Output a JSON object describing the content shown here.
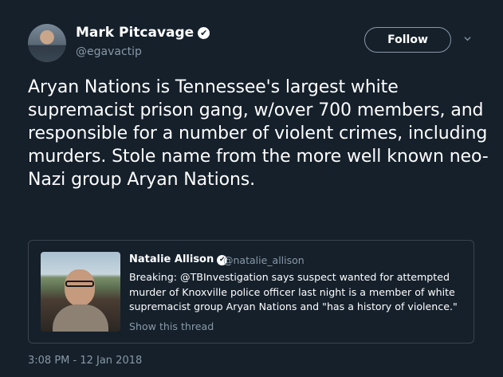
{
  "tweet": {
    "author_name": "Mark Pitcavage",
    "author_handle": "@egavactip",
    "verified_mark": "✔",
    "follow_label": "Follow",
    "text": "Aryan Nations is Tennessee's largest white supremacist prison gang, w/over 700 members, and responsible for a number of violent crimes, including murders. Stole name from the more well known neo-Nazi group Aryan Nations.",
    "timestamp": "3:08 PM - 12 Jan 2018"
  },
  "quote": {
    "author_name": "Natalie Allison",
    "author_handle": "@natalie_allison",
    "verified_mark": "✔",
    "text": "Breaking: @TBInvestigation says suspect wanted for attempted murder of Knoxville police officer last night is a member of white supremacist group Aryan Nations and \"has a history of violence.\"",
    "show_thread": "Show this thread"
  },
  "colors": {
    "background": "#15202b",
    "secondary_text": "#8899a6",
    "border": "#38444d"
  },
  "icons": [
    "verified-badge-icon",
    "chevron-down-icon"
  ]
}
